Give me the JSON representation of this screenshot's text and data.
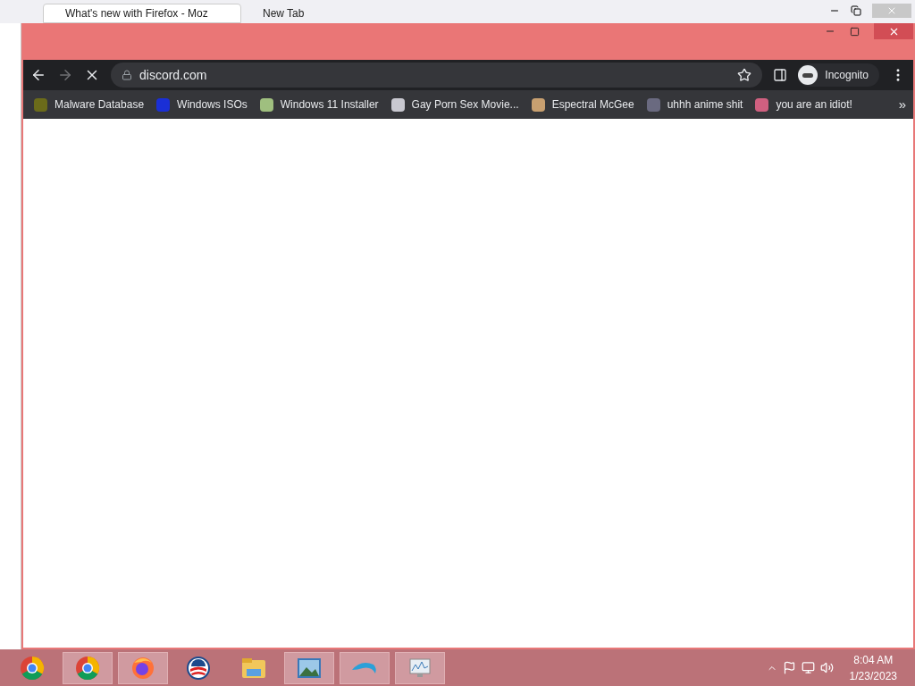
{
  "background_window": {
    "tabs": [
      {
        "title": "What's new with Firefox - Moz",
        "selected": true
      },
      {
        "title": "New Tab",
        "selected": false
      }
    ]
  },
  "browser": {
    "address": "discord.com",
    "loading": true,
    "profile_label": "Incognito",
    "bookmarks": [
      {
        "label": "Malware Database",
        "color": "#6b6b1a"
      },
      {
        "label": "Windows ISOs",
        "color": "#1a2fd6"
      },
      {
        "label": "Windows 11 Installer",
        "color": "#9fbf7f"
      },
      {
        "label": "Gay Porn Sex Movie...",
        "color": "#c8c8d0"
      },
      {
        "label": "Espectral McGee",
        "color": "#c8a070"
      },
      {
        "label": "uhhh anime shit",
        "color": "#6a6a80"
      },
      {
        "label": "you are an idiot!",
        "color": "#d06080"
      }
    ],
    "overflow": "»"
  },
  "taskbar": {
    "apps": [
      {
        "kind": "chrome-old",
        "selected": false
      },
      {
        "kind": "chrome",
        "selected": true
      },
      {
        "kind": "firefox",
        "selected": true
      },
      {
        "kind": "logo",
        "selected": false
      },
      {
        "kind": "folder",
        "selected": false
      },
      {
        "kind": "photo",
        "selected": true
      },
      {
        "kind": "dolphin",
        "selected": true
      },
      {
        "kind": "monitor",
        "selected": true
      }
    ],
    "time": "8:04 AM",
    "date": "1/23/2023"
  }
}
